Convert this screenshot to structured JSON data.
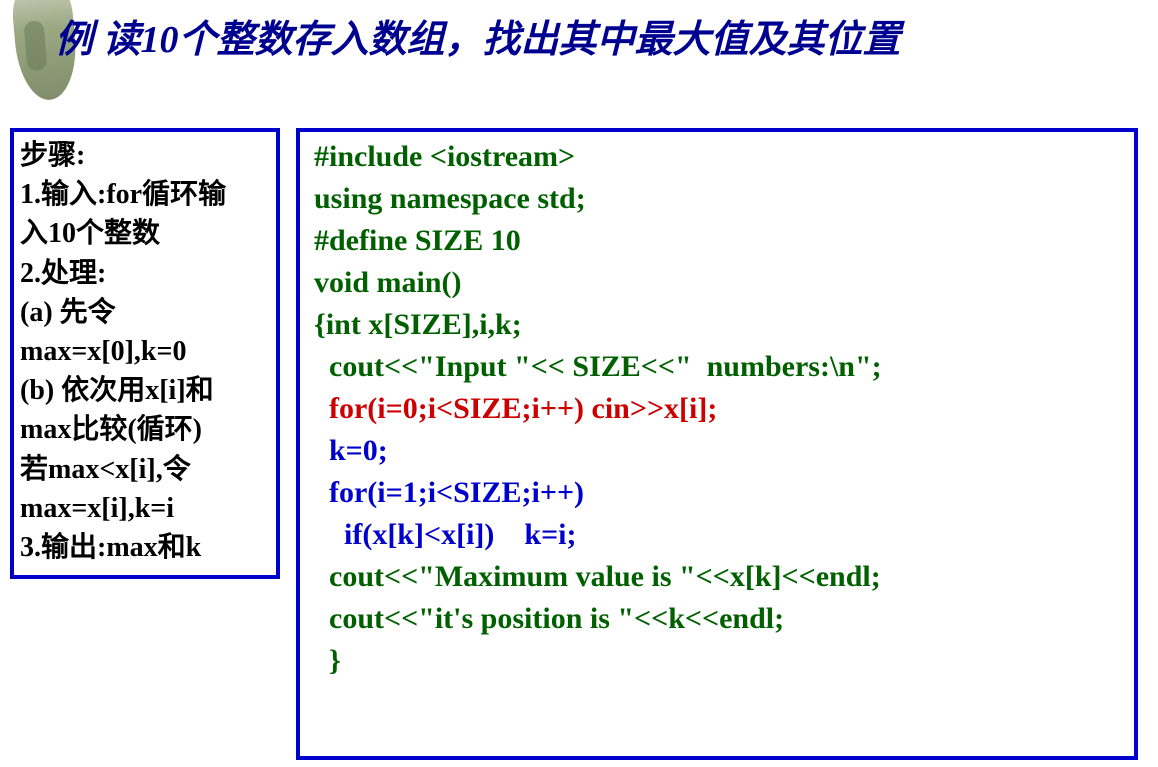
{
  "title": "例    读10个整数存入数组，找出其中最大值及其位置",
  "steps": {
    "l0": "步骤:",
    "l1": "1.输入:for循环输",
    "l2": "入10个整数",
    "l3": "2.处理:",
    "l4": "(a) 先令",
    "l5": "max=x[0],k=0",
    "l6": "(b) 依次用x[i]和",
    "l7": "max比较(循环)",
    "l8": "  若max<x[i],令",
    "l9": "    max=x[i],k=i",
    "l10": "3.输出:max和k"
  },
  "code": {
    "l1": "#include <iostream>",
    "l2": "using namespace std;",
    "l3": "#define SIZE 10",
    "l4": "void main()",
    "l5": "{int x[SIZE],i,k;",
    "l6": "  cout<<\"Input \"<< SIZE<<\"  numbers:\\n\";",
    "l7": "  for(i=0;i<SIZE;i++) cin>>x[i];",
    "l8": "  k=0;",
    "l9": "  for(i=1;i<SIZE;i++)",
    "l10": "    if(x[k]<x[i])    k=i;",
    "l11": "  cout<<\"Maximum value is \"<<x[k]<<endl;",
    "l12": "  cout<<\"it's position is \"<<k<<endl;",
    "l13": "  }"
  }
}
